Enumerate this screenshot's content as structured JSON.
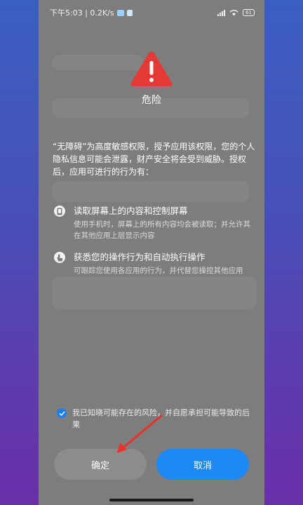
{
  "status_bar": {
    "time_speed": "下午5:03 | 0.2K/s",
    "battery": "61"
  },
  "dialog": {
    "title": "危险",
    "intro": "“无障碍”为高度敏感权限，授予应用该权限，您的个人隐私信息可能会泄露，财产安全将会受到威胁。授权后，应用可进行的行为有：",
    "permissions": [
      {
        "icon": "phone-screen-icon",
        "title": "读取屏幕上的内容和控制屏幕",
        "desc": "使用手机时，屏幕上的所有内容均会被读取；并允许其在其他应用上层显示内容"
      },
      {
        "icon": "hand-pointer-icon",
        "title": "获悉您的操作行为和自动执行操作",
        "desc": "可跟踪您使用各应用的行为，并代替您操控其他应用"
      }
    ],
    "consent": "我已知晓可能存在的风险，并自愿承担可能导致的后果",
    "consent_checked": true,
    "confirm_label": "确定",
    "cancel_label": "取消"
  },
  "colors": {
    "overlay": "#7d7d7d",
    "warning_red": "#e53935",
    "accent_blue": "#1e88f5",
    "annotation_arrow": "#e8322a"
  }
}
